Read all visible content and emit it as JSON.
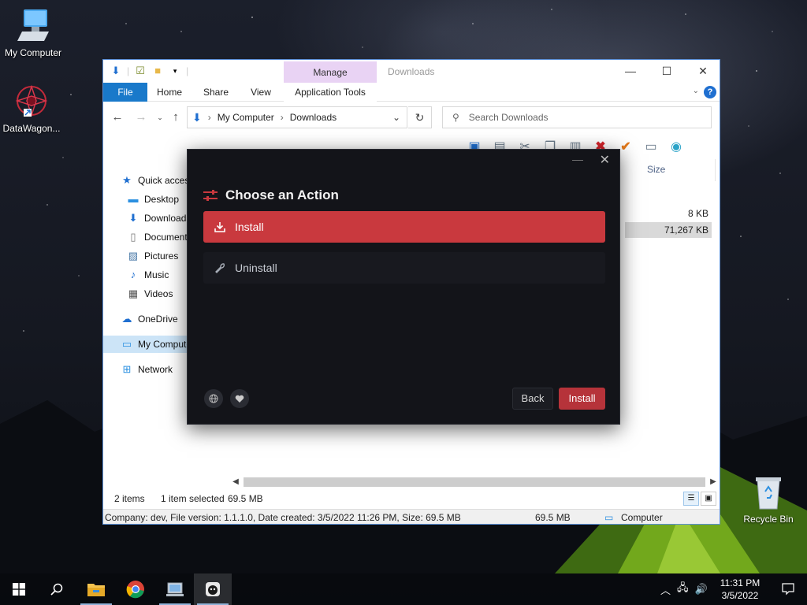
{
  "desktop": {
    "icons": [
      {
        "label": "My Computer",
        "icon": "computer-icon"
      },
      {
        "label": "DataWagon...",
        "icon": "app-shortcut-icon"
      },
      {
        "label": "Recycle Bin",
        "icon": "recycle-bin-icon"
      }
    ]
  },
  "explorer": {
    "title": "Downloads",
    "manage_tab": "Manage",
    "ribbon_tabs": [
      "File",
      "Home",
      "Share",
      "View",
      "Application Tools"
    ],
    "address": {
      "root": "My Computer",
      "current": "Downloads"
    },
    "search_placeholder": "Search Downloads",
    "nav_items": {
      "quick_access": "Quick access",
      "desktop": "Desktop",
      "downloads": "Downloads",
      "documents": "Documents",
      "pictures": "Pictures",
      "music": "Music",
      "videos": "Videos",
      "onedrive": "OneDrive",
      "my_computer": "My Computer",
      "network": "Network"
    },
    "column_size": "Size",
    "file_sizes": [
      "8 KB",
      "71,267 KB"
    ],
    "status": {
      "items": "2 items",
      "selected": "1 item selected",
      "sel_size": "69.5 MB"
    },
    "details": {
      "text": "Company: dev, File version: 1.1.1.0, Date created: 3/5/2022 11:26 PM, Size: 69.5 MB",
      "size": "69.5 MB",
      "location": "Computer"
    }
  },
  "dialog": {
    "heading": "Choose an Action",
    "install_option": "Install",
    "uninstall_option": "Uninstall",
    "back_button": "Back",
    "install_button": "Install",
    "accent_color": "#c9393e"
  },
  "taskbar": {
    "time": "11:31 PM",
    "date": "3/5/2022"
  }
}
